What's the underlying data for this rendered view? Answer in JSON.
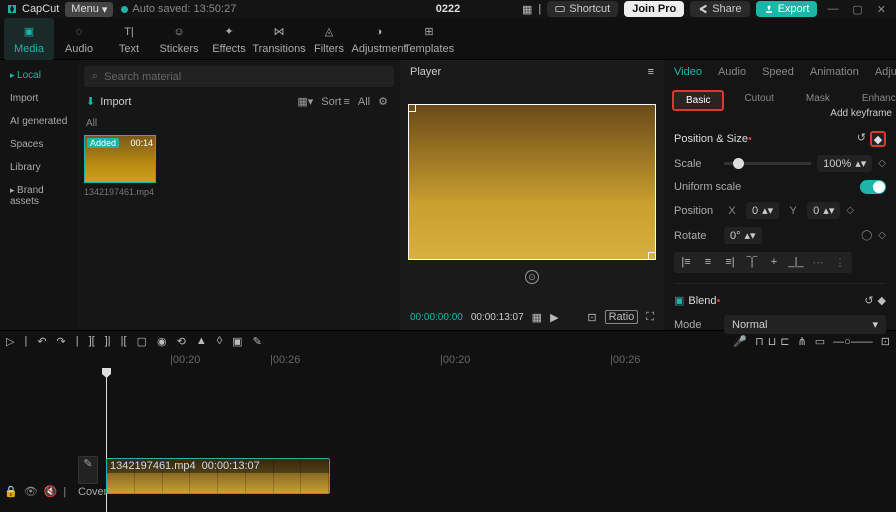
{
  "top": {
    "brand": "CapCut",
    "menu": "Menu",
    "autosave": "Auto saved: 13:50:27",
    "title": "0222",
    "shortcut": "Shortcut",
    "joinpro": "Join Pro",
    "share": "Share",
    "export": "Export"
  },
  "tools": [
    "Media",
    "Audio",
    "Text",
    "Stickers",
    "Effects",
    "Transitions",
    "Filters",
    "Adjustment",
    "Templates"
  ],
  "leftnav": {
    "local": "Local",
    "import": "Import",
    "ai": "AI generated",
    "spaces": "Spaces",
    "library": "Library",
    "brand": "Brand assets"
  },
  "assets": {
    "search_ph": "Search material",
    "import": "Import",
    "sort": "Sort",
    "all": "All",
    "all_lbl": "All",
    "clip": {
      "badge": "Added",
      "dur": "00:14",
      "name": "1342197461.mp4"
    }
  },
  "player": {
    "label": "Player",
    "t1": "00:00:00:00",
    "t2": "00:00:13:07",
    "ratio": "Ratio"
  },
  "inspector": {
    "tabs": [
      "Video",
      "Audio",
      "Speed",
      "Animation",
      "Adjust"
    ],
    "subtabs": [
      "Basic",
      "Cutout",
      "Mask",
      "Enhance"
    ],
    "pos_size": "Position & Size",
    "add_kf": "Add keyframe",
    "scale": "Scale",
    "scale_val": "100%",
    "uniform": "Uniform scale",
    "position": "Position",
    "px": "0",
    "py": "0",
    "rotate": "Rotate",
    "rot_val": "0°",
    "blend": "Blend",
    "mode": "Mode",
    "mode_val": "Normal"
  },
  "timeline": {
    "marks": [
      "|00:20",
      "|00:26",
      "|00:20",
      "|00:26"
    ],
    "clip_name": "1342197461.mp4",
    "clip_dur": "00:00:13:07",
    "cover": "Cover"
  }
}
